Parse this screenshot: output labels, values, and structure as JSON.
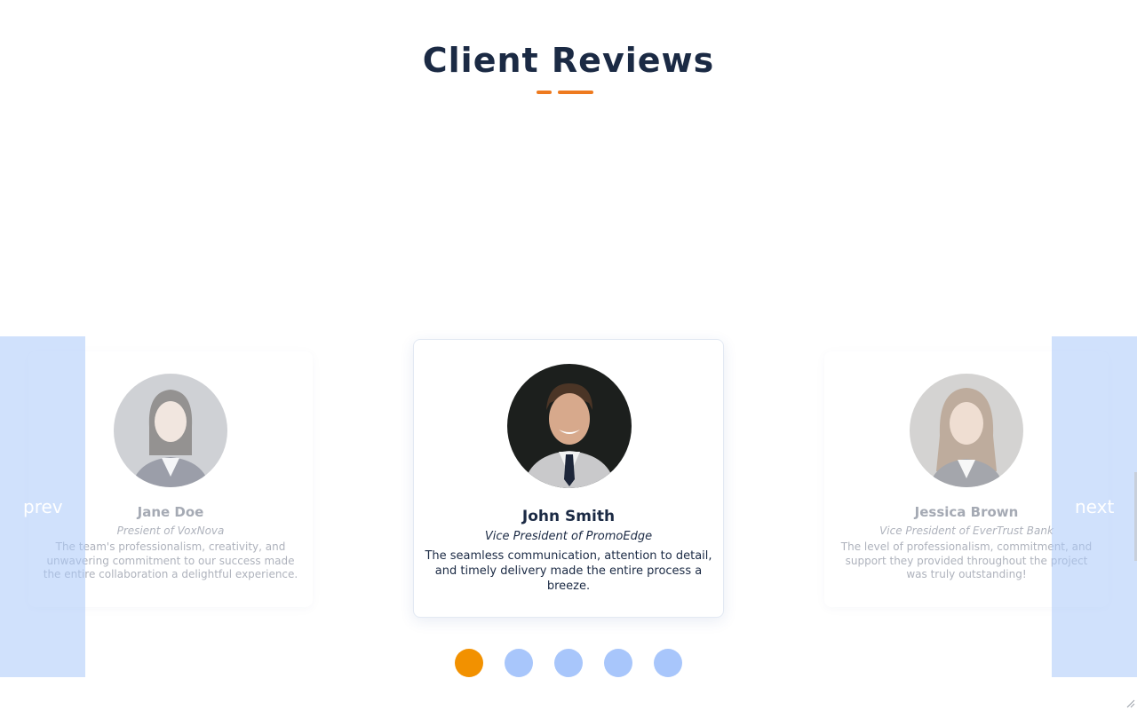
{
  "section": {
    "title": "Client Reviews",
    "accent_color": "#ee7a1f"
  },
  "carousel": {
    "prev_label": "prev",
    "next_label": "next",
    "reviews": [
      {
        "name": "Jane Doe",
        "role": "Presient of VoxNova",
        "quote": "The team's professionalism, creativity, and unwavering commitment to our success made the entire collaboration a delightful experience."
      },
      {
        "name": "John Smith",
        "role": "Vice President of PromoEdge",
        "quote": "The seamless communication, attention to detail, and timely delivery made the entire process a breeze."
      },
      {
        "name": "Jessica Brown",
        "role": "Vice President of EverTrust Bank",
        "quote": "The level of professionalism, commitment, and support they provided throughout the project was truly outstanding!"
      }
    ],
    "dots": {
      "count": 5,
      "active_index": 0,
      "active_color": "#f29100",
      "inactive_color": "#a8c6fb"
    }
  }
}
